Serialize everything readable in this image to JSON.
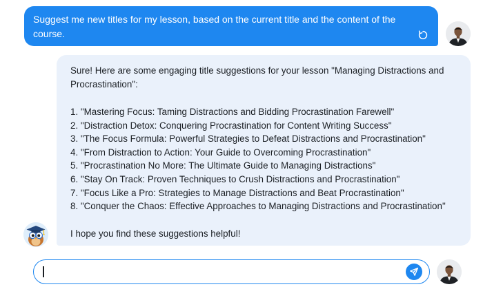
{
  "colors": {
    "accent": "#1e87f0",
    "assistant_bubble": "#eaf1fb",
    "text": "#1b1f24"
  },
  "user_message": {
    "text": "Suggest me new titles for my lesson, based on the current title and the content of the course.",
    "regenerate_icon": "refresh-icon"
  },
  "assistant_message": {
    "intro": "Sure! Here are some engaging title suggestions for your lesson \"Managing Distractions and Procrastination\":",
    "suggestions": [
      "1. \"Mastering Focus: Taming Distractions and Bidding Procrastination Farewell\"",
      "2. \"Distraction Detox: Conquering Procrastination for Content Writing Success\"",
      "3. \"The Focus Formula: Powerful Strategies to Defeat Distractions and Procrastination\"",
      "4. \"From Distraction to Action: Your Guide to Overcoming Procrastination\"",
      "5. \"Procrastination No More: The Ultimate Guide to Managing Distractions\"",
      "6. \"Stay On Track: Proven Techniques to Crush Distractions and Procrastination\"",
      "7. \"Focus Like a Pro: Strategies to Manage Distractions and Beat Procrastination\"",
      "8. \"Conquer the Chaos: Effective Approaches to Managing Distractions and Procrastination\""
    ],
    "closing": "I hope you find these suggestions helpful!"
  },
  "input": {
    "value": "",
    "placeholder": "",
    "send_icon": "send-icon"
  },
  "avatars": {
    "user": "user-avatar",
    "assistant": "owl-graduate-avatar"
  }
}
